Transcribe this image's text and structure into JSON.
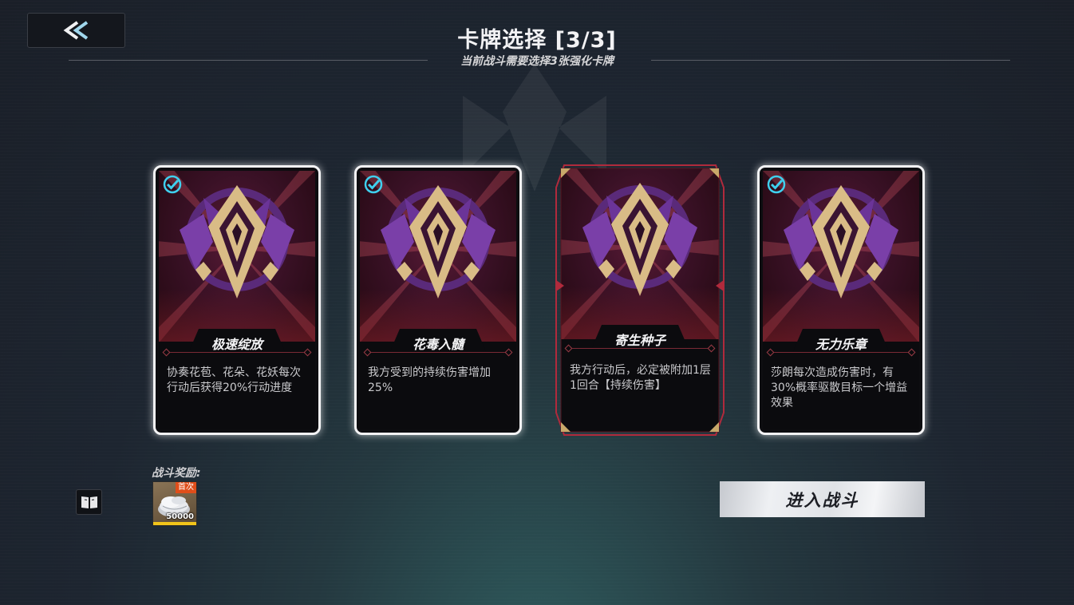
{
  "header": {
    "title": "卡牌选择 [3/3]",
    "subtitle": "当前战斗需要选择3张强化卡牌"
  },
  "cards": [
    {
      "name": "极速绽放",
      "desc": "协奏花苞、花朵、花妖每次行动后获得20%行动进度",
      "selected": true
    },
    {
      "name": "花毒入髓",
      "desc": "我方受到的持续伤害增加25%",
      "selected": true
    },
    {
      "name": "寄生种子",
      "desc": "我方行动后，必定被附加1层1回合【持续伤害】",
      "selected": false
    },
    {
      "name": "无力乐章",
      "desc": "莎朗每次造成伤害时，有30%概率驱散目标一个增益效果",
      "selected": true
    }
  ],
  "reward": {
    "label": "战斗奖励:",
    "badge": "首次",
    "count": "50000",
    "icon": "silver-coins-icon"
  },
  "buttons": {
    "enter": "进入战斗"
  },
  "colors": {
    "accent_check": "#3fd0ee",
    "card_frame_selected": "#f4f4f6",
    "card_frame_unselected": "#b02a3c",
    "emblem_purple": "#7a3fa8",
    "emblem_gold": "#d9bc86"
  }
}
